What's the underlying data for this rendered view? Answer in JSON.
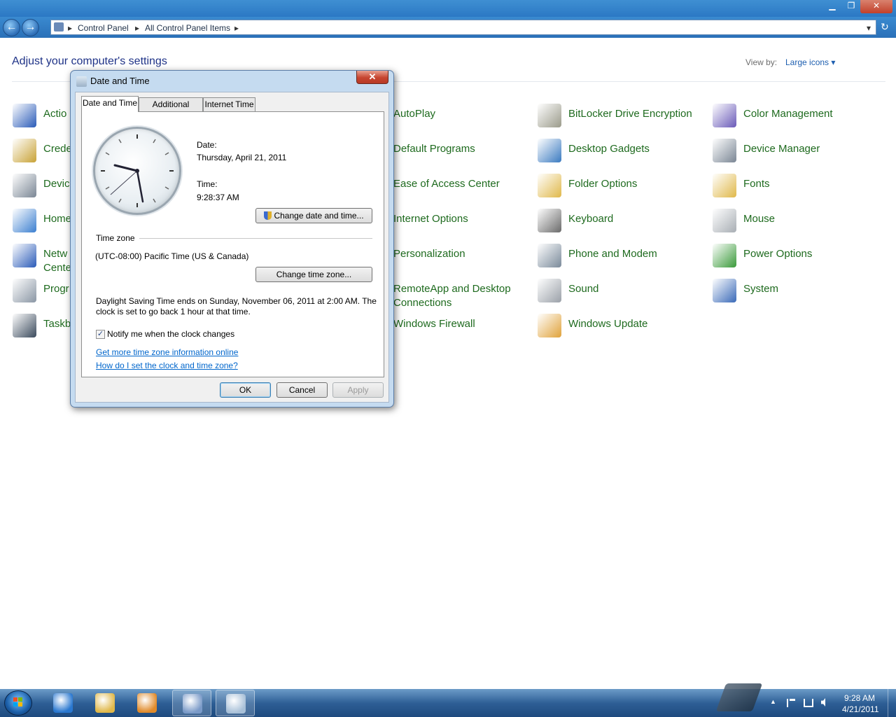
{
  "window": {
    "minimize": "▁",
    "restore": "❐",
    "close": "✕"
  },
  "address": {
    "back": "←",
    "forward": "→",
    "crumbs": [
      "Control Panel",
      "All Control Panel Items"
    ],
    "sep": "▸",
    "dropdown": "▾",
    "refresh": "↻"
  },
  "content": {
    "heading": "Adjust your computer's settings",
    "view_by_label": "View by:",
    "view_by_value": "Large icons ▾",
    "items": [
      {
        "label": "Action Center",
        "visible": "Actio",
        "color": "#2a5bb8"
      },
      {
        "label": "Credential Manager",
        "visible": "Crede",
        "color": "#c8a236"
      },
      {
        "label": "Devices and Printers",
        "visible": "Devic",
        "color": "#7a8694"
      },
      {
        "label": "HomeGroup",
        "visible": "Home",
        "color": "#3b7fd0"
      },
      {
        "label": "Network and Sharing Center",
        "visible": "Netw",
        "visible2": "Cente",
        "color": "#2a5bb8"
      },
      {
        "label": "Programs and Features",
        "visible": "Progr",
        "color": "#8a96a4"
      },
      {
        "label": "Taskbar and Start Menu",
        "visible": "Taskb",
        "color": "#3a4a5c"
      },
      {
        "label": "AutoPlay",
        "color": "#4a8a3a"
      },
      {
        "label": "Default Programs",
        "color": "#3a8a3a"
      },
      {
        "label": "Ease of Access Center",
        "color": "#2a7ac8"
      },
      {
        "label": "Internet Options",
        "color": "#3a8ad0"
      },
      {
        "label": "Personalization",
        "color": "#c86a2a"
      },
      {
        "label": "RemoteApp and Desktop",
        "label2": "Connections",
        "color": "#4a6a9a"
      },
      {
        "label": "Windows Firewall",
        "color": "#b85a2a"
      },
      {
        "label": "BitLocker Drive Encryption",
        "color": "#9a9a8a"
      },
      {
        "label": "Desktop Gadgets",
        "color": "#3a7ac0"
      },
      {
        "label": "Folder Options",
        "color": "#e0b84a"
      },
      {
        "label": "Keyboard",
        "color": "#6a6a6a"
      },
      {
        "label": "Phone and Modem",
        "color": "#7a8a9a"
      },
      {
        "label": "Sound",
        "color": "#9aa0a8"
      },
      {
        "label": "Windows Update",
        "color": "#e0a23a"
      },
      {
        "label": "Color Management",
        "color": "#6a5ab8"
      },
      {
        "label": "Device Manager",
        "color": "#7a8694"
      },
      {
        "label": "Fonts",
        "color": "#e0b84a"
      },
      {
        "label": "Mouse",
        "color": "#a8aeb4"
      },
      {
        "label": "Power Options",
        "color": "#3a9a3a"
      },
      {
        "label": "System",
        "color": "#3a6ab8"
      }
    ]
  },
  "dialog": {
    "title": "Date and Time",
    "close": "✕",
    "tabs": [
      "Date and Time",
      "Additional Clocks",
      "Internet Time"
    ],
    "date_label": "Date:",
    "date_value": "Thursday, April 21, 2011",
    "time_label": "Time:",
    "time_value": "9:28:37 AM",
    "change_datetime_button": "Change date and time...",
    "timezone_heading": "Time zone",
    "timezone_value": "(UTC-08:00) Pacific Time (US & Canada)",
    "change_timezone_button": "Change time zone...",
    "dst_line1": "Daylight Saving Time ends on Sunday, November 06, 2011 at 2:00 AM. The",
    "dst_line2": "clock is set to go back 1 hour at that time.",
    "notify_checkbox": "Notify me when the clock changes",
    "notify_checked": "✓",
    "link_more_info": "Get more time zone information online",
    "link_how_set": "How do I set the clock and time zone?",
    "ok": "OK",
    "cancel": "Cancel",
    "apply": "Apply"
  },
  "taskbar": {
    "tray_up": "▲",
    "clock_time": "9:28 AM",
    "clock_date": "4/21/2011",
    "app_colors": [
      "#2a78d0",
      "#e0b84a",
      "#e08a2a",
      "#7a9ac8",
      "#a8c0d8"
    ]
  }
}
